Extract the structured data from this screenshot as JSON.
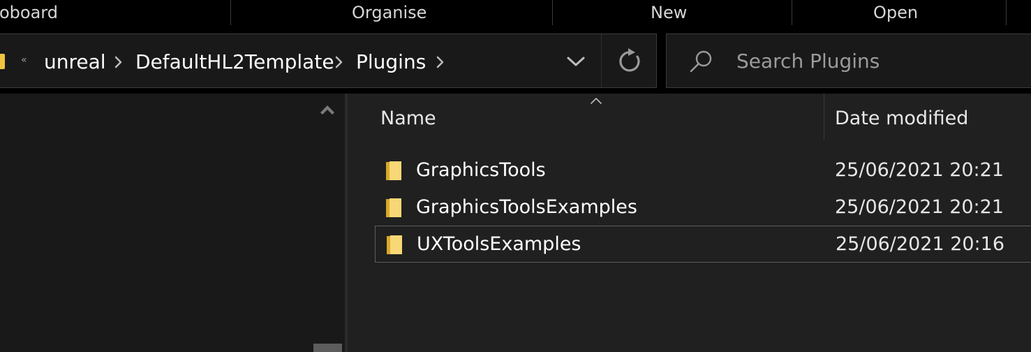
{
  "ribbon": {
    "groups": [
      "oboard",
      "Organise",
      "New",
      "Open"
    ]
  },
  "address_bar": {
    "overflow_glyph": "«",
    "breadcrumbs": [
      "unreal",
      "DefaultHL2Template",
      "Plugins"
    ],
    "icons": [
      "folder-icon",
      "chevron-right-icon",
      "chevron-down-icon",
      "refresh-icon"
    ]
  },
  "search": {
    "placeholder": "Search Plugins",
    "value": "",
    "icon": "search-icon"
  },
  "file_list": {
    "columns": [
      "Name",
      "Date modified"
    ],
    "sort": {
      "column": "Name",
      "direction": "ascending",
      "icon": "sort-up-icon"
    },
    "rows": [
      {
        "name": "GraphicsTools",
        "date_modified": "25/06/2021 20:21",
        "type_icon": "folder-icon",
        "selected": false
      },
      {
        "name": "GraphicsToolsExamples",
        "date_modified": "25/06/2021 20:21",
        "type_icon": "folder-icon",
        "selected": false
      },
      {
        "name": "UXToolsExamples",
        "date_modified": "25/06/2021 20:16",
        "type_icon": "folder-icon",
        "selected": true
      }
    ]
  },
  "colors": {
    "background": "#000000",
    "pane_dark": "#191919",
    "file_pane": "#202020",
    "folder_yellow": "#f0c440",
    "text": "#ffffff",
    "muted_text": "#9b9b9b"
  }
}
